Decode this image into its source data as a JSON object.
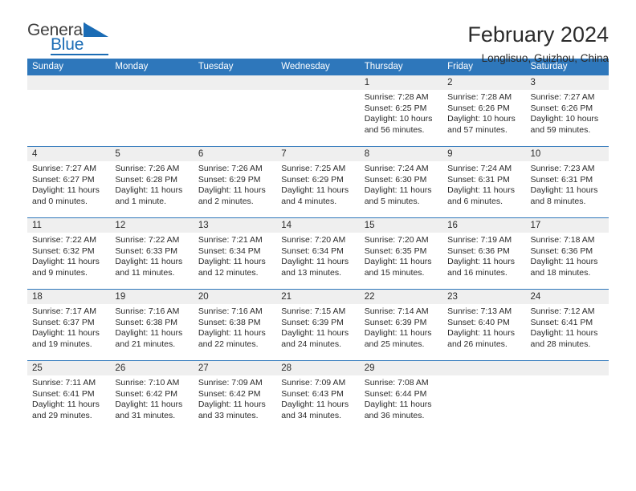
{
  "brand": {
    "name_top": "General",
    "name_bottom": "Blue",
    "accent_color": "#1b6cb5"
  },
  "header": {
    "title": "February 2024",
    "subtitle": "Longlisuo, Guizhou, China"
  },
  "calendar": {
    "header_bg": "#2e77bb",
    "daynum_bg": "#efefef",
    "weekday_names": [
      "Sunday",
      "Monday",
      "Tuesday",
      "Wednesday",
      "Thursday",
      "Friday",
      "Saturday"
    ],
    "labels": {
      "sunrise": "Sunrise:",
      "sunset": "Sunset:",
      "daylight": "Daylight:"
    },
    "weeks": [
      [
        {
          "day": "",
          "empty": true
        },
        {
          "day": "",
          "empty": true
        },
        {
          "day": "",
          "empty": true
        },
        {
          "day": "",
          "empty": true
        },
        {
          "day": "1",
          "sunrise": "Sunrise: 7:28 AM",
          "sunset": "Sunset: 6:25 PM",
          "daylight_1": "Daylight: 10 hours",
          "daylight_2": "and 56 minutes."
        },
        {
          "day": "2",
          "sunrise": "Sunrise: 7:28 AM",
          "sunset": "Sunset: 6:26 PM",
          "daylight_1": "Daylight: 10 hours",
          "daylight_2": "and 57 minutes."
        },
        {
          "day": "3",
          "sunrise": "Sunrise: 7:27 AM",
          "sunset": "Sunset: 6:26 PM",
          "daylight_1": "Daylight: 10 hours",
          "daylight_2": "and 59 minutes."
        }
      ],
      [
        {
          "day": "4",
          "sunrise": "Sunrise: 7:27 AM",
          "sunset": "Sunset: 6:27 PM",
          "daylight_1": "Daylight: 11 hours",
          "daylight_2": "and 0 minutes."
        },
        {
          "day": "5",
          "sunrise": "Sunrise: 7:26 AM",
          "sunset": "Sunset: 6:28 PM",
          "daylight_1": "Daylight: 11 hours",
          "daylight_2": "and 1 minute."
        },
        {
          "day": "6",
          "sunrise": "Sunrise: 7:26 AM",
          "sunset": "Sunset: 6:29 PM",
          "daylight_1": "Daylight: 11 hours",
          "daylight_2": "and 2 minutes."
        },
        {
          "day": "7",
          "sunrise": "Sunrise: 7:25 AM",
          "sunset": "Sunset: 6:29 PM",
          "daylight_1": "Daylight: 11 hours",
          "daylight_2": "and 4 minutes."
        },
        {
          "day": "8",
          "sunrise": "Sunrise: 7:24 AM",
          "sunset": "Sunset: 6:30 PM",
          "daylight_1": "Daylight: 11 hours",
          "daylight_2": "and 5 minutes."
        },
        {
          "day": "9",
          "sunrise": "Sunrise: 7:24 AM",
          "sunset": "Sunset: 6:31 PM",
          "daylight_1": "Daylight: 11 hours",
          "daylight_2": "and 6 minutes."
        },
        {
          "day": "10",
          "sunrise": "Sunrise: 7:23 AM",
          "sunset": "Sunset: 6:31 PM",
          "daylight_1": "Daylight: 11 hours",
          "daylight_2": "and 8 minutes."
        }
      ],
      [
        {
          "day": "11",
          "sunrise": "Sunrise: 7:22 AM",
          "sunset": "Sunset: 6:32 PM",
          "daylight_1": "Daylight: 11 hours",
          "daylight_2": "and 9 minutes."
        },
        {
          "day": "12",
          "sunrise": "Sunrise: 7:22 AM",
          "sunset": "Sunset: 6:33 PM",
          "daylight_1": "Daylight: 11 hours",
          "daylight_2": "and 11 minutes."
        },
        {
          "day": "13",
          "sunrise": "Sunrise: 7:21 AM",
          "sunset": "Sunset: 6:34 PM",
          "daylight_1": "Daylight: 11 hours",
          "daylight_2": "and 12 minutes."
        },
        {
          "day": "14",
          "sunrise": "Sunrise: 7:20 AM",
          "sunset": "Sunset: 6:34 PM",
          "daylight_1": "Daylight: 11 hours",
          "daylight_2": "and 13 minutes."
        },
        {
          "day": "15",
          "sunrise": "Sunrise: 7:20 AM",
          "sunset": "Sunset: 6:35 PM",
          "daylight_1": "Daylight: 11 hours",
          "daylight_2": "and 15 minutes."
        },
        {
          "day": "16",
          "sunrise": "Sunrise: 7:19 AM",
          "sunset": "Sunset: 6:36 PM",
          "daylight_1": "Daylight: 11 hours",
          "daylight_2": "and 16 minutes."
        },
        {
          "day": "17",
          "sunrise": "Sunrise: 7:18 AM",
          "sunset": "Sunset: 6:36 PM",
          "daylight_1": "Daylight: 11 hours",
          "daylight_2": "and 18 minutes."
        }
      ],
      [
        {
          "day": "18",
          "sunrise": "Sunrise: 7:17 AM",
          "sunset": "Sunset: 6:37 PM",
          "daylight_1": "Daylight: 11 hours",
          "daylight_2": "and 19 minutes."
        },
        {
          "day": "19",
          "sunrise": "Sunrise: 7:16 AM",
          "sunset": "Sunset: 6:38 PM",
          "daylight_1": "Daylight: 11 hours",
          "daylight_2": "and 21 minutes."
        },
        {
          "day": "20",
          "sunrise": "Sunrise: 7:16 AM",
          "sunset": "Sunset: 6:38 PM",
          "daylight_1": "Daylight: 11 hours",
          "daylight_2": "and 22 minutes."
        },
        {
          "day": "21",
          "sunrise": "Sunrise: 7:15 AM",
          "sunset": "Sunset: 6:39 PM",
          "daylight_1": "Daylight: 11 hours",
          "daylight_2": "and 24 minutes."
        },
        {
          "day": "22",
          "sunrise": "Sunrise: 7:14 AM",
          "sunset": "Sunset: 6:39 PM",
          "daylight_1": "Daylight: 11 hours",
          "daylight_2": "and 25 minutes."
        },
        {
          "day": "23",
          "sunrise": "Sunrise: 7:13 AM",
          "sunset": "Sunset: 6:40 PM",
          "daylight_1": "Daylight: 11 hours",
          "daylight_2": "and 26 minutes."
        },
        {
          "day": "24",
          "sunrise": "Sunrise: 7:12 AM",
          "sunset": "Sunset: 6:41 PM",
          "daylight_1": "Daylight: 11 hours",
          "daylight_2": "and 28 minutes."
        }
      ],
      [
        {
          "day": "25",
          "sunrise": "Sunrise: 7:11 AM",
          "sunset": "Sunset: 6:41 PM",
          "daylight_1": "Daylight: 11 hours",
          "daylight_2": "and 29 minutes."
        },
        {
          "day": "26",
          "sunrise": "Sunrise: 7:10 AM",
          "sunset": "Sunset: 6:42 PM",
          "daylight_1": "Daylight: 11 hours",
          "daylight_2": "and 31 minutes."
        },
        {
          "day": "27",
          "sunrise": "Sunrise: 7:09 AM",
          "sunset": "Sunset: 6:42 PM",
          "daylight_1": "Daylight: 11 hours",
          "daylight_2": "and 33 minutes."
        },
        {
          "day": "28",
          "sunrise": "Sunrise: 7:09 AM",
          "sunset": "Sunset: 6:43 PM",
          "daylight_1": "Daylight: 11 hours",
          "daylight_2": "and 34 minutes."
        },
        {
          "day": "29",
          "sunrise": "Sunrise: 7:08 AM",
          "sunset": "Sunset: 6:44 PM",
          "daylight_1": "Daylight: 11 hours",
          "daylight_2": "and 36 minutes."
        },
        {
          "day": "",
          "empty": true
        },
        {
          "day": "",
          "empty": true
        }
      ]
    ]
  }
}
